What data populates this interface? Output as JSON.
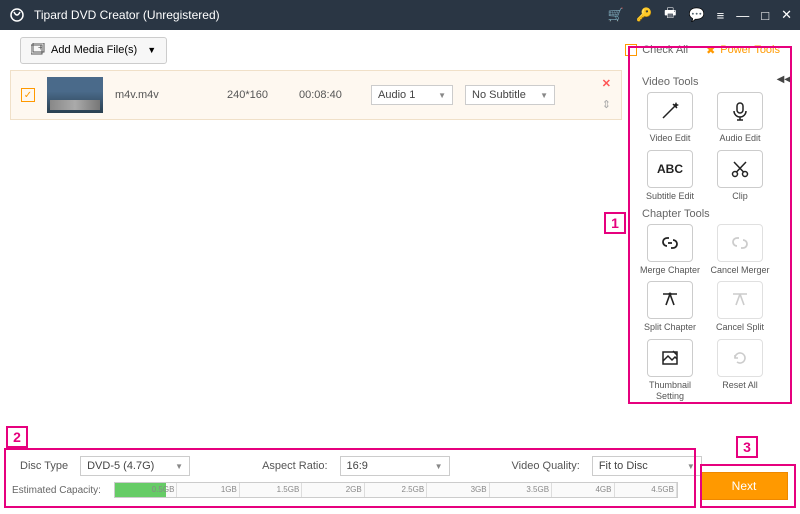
{
  "window": {
    "title": "Tipard DVD Creator (Unregistered)"
  },
  "toolbar": {
    "add_media": "Add Media File(s)",
    "check_all": "Check All",
    "power_tools": "Power Tools"
  },
  "file": {
    "name": "m4v.m4v",
    "resolution": "240*160",
    "duration": "00:08:40",
    "audio_selected": "Audio 1",
    "subtitle_selected": "No Subtitle"
  },
  "video_tools": {
    "title": "Video Tools",
    "edit": "Video Edit",
    "audio": "Audio Edit",
    "subtitle": "Subtitle Edit",
    "clip": "Clip"
  },
  "chapter_tools": {
    "title": "Chapter Tools",
    "merge": "Merge Chapter",
    "cancel_merge": "Cancel Merger",
    "split": "Split Chapter",
    "cancel_split": "Cancel Split",
    "thumbnail": "Thumbnail Setting",
    "reset": "Reset All"
  },
  "bottom": {
    "disc_type_label": "Disc Type",
    "disc_type": "DVD-5 (4.7G)",
    "aspect_label": "Aspect Ratio:",
    "aspect": "16:9",
    "quality_label": "Video Quality:",
    "quality": "Fit to Disc",
    "capacity_label": "Estimated Capacity:",
    "ticks": [
      "0.5GB",
      "1GB",
      "1.5GB",
      "2GB",
      "2.5GB",
      "3GB",
      "3.5GB",
      "4GB",
      "4.5GB"
    ],
    "fill_percent": 9,
    "next": "Next"
  },
  "annotations": {
    "a1": "1",
    "a2": "2",
    "a3": "3"
  }
}
